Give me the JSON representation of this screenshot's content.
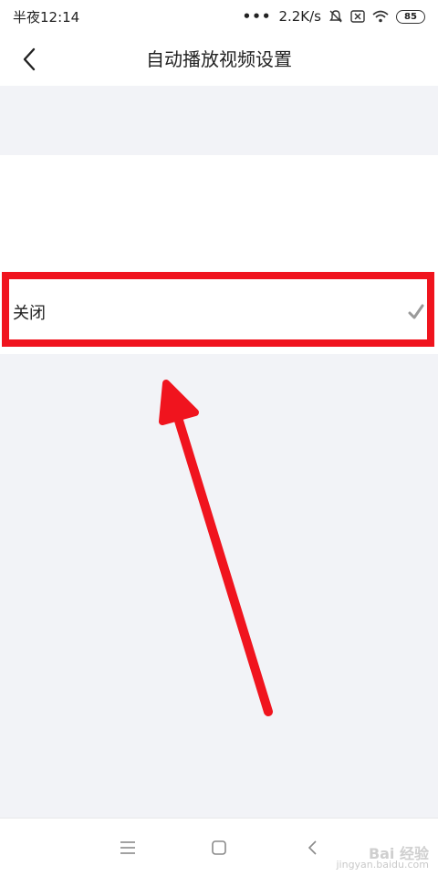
{
  "status_bar": {
    "time": "半夜12:14",
    "dots": "•••",
    "network_speed": "2.2K/s",
    "battery_level": "85",
    "icons": [
      "mute-icon",
      "sim-icon",
      "wifi-icon",
      "battery-icon"
    ]
  },
  "header": {
    "back_icon": "chevron-left-icon",
    "title": "自动播放视频设置"
  },
  "options": [
    {
      "label": "关闭",
      "selected": true,
      "check_icon": "checkmark-icon"
    }
  ],
  "annotation": {
    "highlight_color": "#f0141e",
    "arrow_color": "#f0141e"
  },
  "nav_bar": {
    "icons": [
      "menu-icon",
      "home-square-icon",
      "back-triangle-icon"
    ]
  },
  "watermark": {
    "main": "Bai 经验",
    "sub": "jingyan.baidu.com"
  },
  "colors": {
    "background": "#f2f3f7",
    "surface": "#ffffff",
    "text": "#222222",
    "check": "#9a9a9a"
  }
}
